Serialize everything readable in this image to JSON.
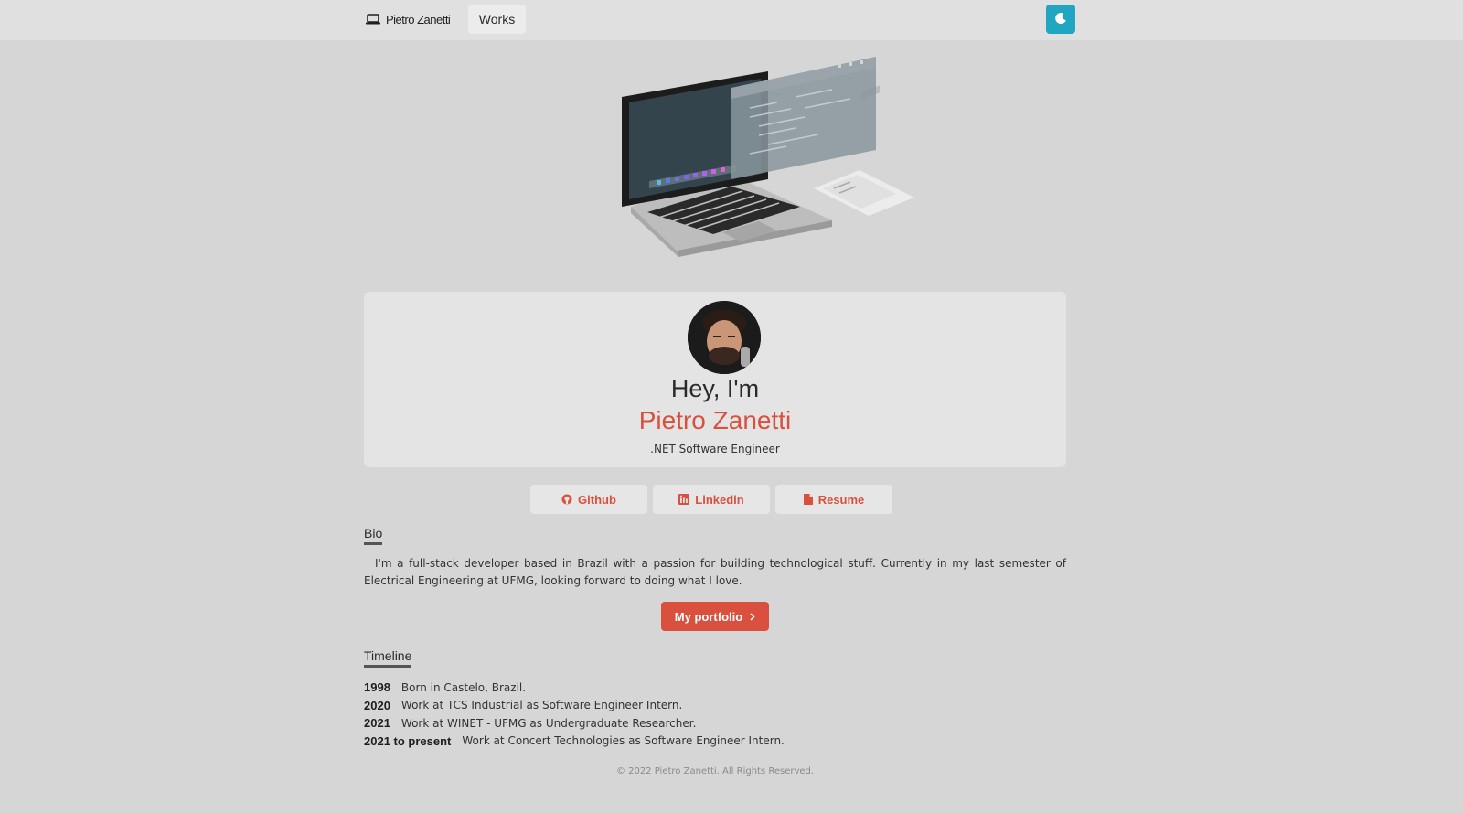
{
  "nav": {
    "logo_text": "Pietro Zanetti",
    "logo_icon": "laptop-icon",
    "works_label": "Works",
    "theme_icon": "moon-icon",
    "theme_color": "#20a6c0"
  },
  "profile": {
    "greeting": "Hey, I'm",
    "name": "Pietro Zanetti",
    "role": ".NET Software Engineer",
    "accent_color": "#d9503e"
  },
  "social": [
    {
      "label": "Github",
      "icon": "github-icon"
    },
    {
      "label": "Linkedin",
      "icon": "linkedin-icon"
    },
    {
      "label": "Resume",
      "icon": "document-icon"
    }
  ],
  "bio": {
    "title": "Bio",
    "text": "I'm a full-stack developer based in Brazil with a passion for building technological stuff. Currently in my last semester of Electrical Engineering at UFMG, looking forward to doing what I love.",
    "portfolio_label": "My portfolio",
    "portfolio_icon": "chevron-right-icon"
  },
  "timeline": {
    "title": "Timeline",
    "items": [
      {
        "year": "1998",
        "text": "Born in Castelo, Brazil."
      },
      {
        "year": "2020",
        "text": "Work at TCS Industrial as Software Engineer Intern."
      },
      {
        "year": "2021",
        "text": "Work at WINET - UFMG as Undergraduate Researcher."
      },
      {
        "year": "2021 to present",
        "text": "Work at Concert Technologies as Software Engineer Intern."
      }
    ]
  },
  "footer": {
    "text": "© 2022 Pietro Zanetti. All Rights Reserved."
  }
}
